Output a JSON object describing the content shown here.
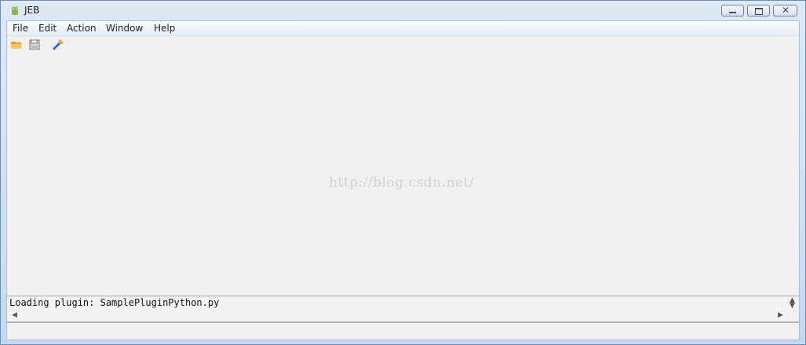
{
  "window": {
    "title": "JEB"
  },
  "menu": [
    {
      "label": "File"
    },
    {
      "label": "Edit"
    },
    {
      "label": "Action"
    },
    {
      "label": "Window"
    },
    {
      "label": "Help"
    }
  ],
  "toolbar": {
    "open_icon": "folder-open-icon",
    "save_icon": "save-icon",
    "settings_icon": "wrench-icon"
  },
  "watermark": "http://blog.csdn.net/",
  "console": {
    "text": "Loading plugin: SamplePluginPython.py"
  },
  "status": {
    "text": ""
  }
}
